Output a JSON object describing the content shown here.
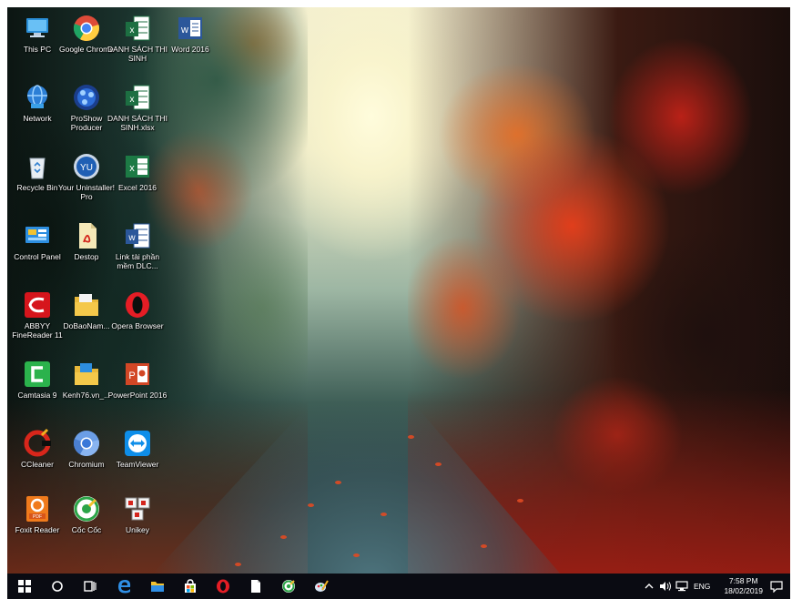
{
  "desktop": {
    "icons": [
      {
        "label": "This PC",
        "icon": "this-pc-icon"
      },
      {
        "label": "Google Chrome",
        "icon": "chrome-icon"
      },
      {
        "label": "DANH SÁCH THI SINH",
        "icon": "excel-file-icon"
      },
      {
        "label": "Word 2016",
        "icon": "word-icon"
      },
      {
        "label": "Network",
        "icon": "network-icon"
      },
      {
        "label": "ProShow Producer",
        "icon": "proshow-icon"
      },
      {
        "label": "DANH SÁCH THI SINH.xlsx",
        "icon": "excel-file-icon"
      },
      {
        "label": "Recycle Bin",
        "icon": "recycle-bin-icon"
      },
      {
        "label": "Your Uninstaller! Pro",
        "icon": "uninstaller-icon"
      },
      {
        "label": "Excel 2016",
        "icon": "excel-icon"
      },
      {
        "label": "Control Panel",
        "icon": "control-panel-icon"
      },
      {
        "label": "Destop",
        "icon": "pdf-file-icon"
      },
      {
        "label": "Link tài phần mềm DLC...",
        "icon": "word-file-icon"
      },
      {
        "label": "ABBYY FineReader 11",
        "icon": "abbyy-icon"
      },
      {
        "label": "DoBaoNam...",
        "icon": "folder-icon"
      },
      {
        "label": "Opera Browser",
        "icon": "opera-icon"
      },
      {
        "label": "Camtasia 9",
        "icon": "camtasia-icon"
      },
      {
        "label": "Kenh76.vn_...",
        "icon": "folder-file-icon"
      },
      {
        "label": "PowerPoint 2016",
        "icon": "powerpoint-icon"
      },
      {
        "label": "CCleaner",
        "icon": "ccleaner-icon"
      },
      {
        "label": "Chromium",
        "icon": "chromium-icon"
      },
      {
        "label": "TeamViewer",
        "icon": "teamviewer-icon"
      },
      {
        "label": "Foxit Reader",
        "icon": "foxit-icon"
      },
      {
        "label": "Cốc Cốc",
        "icon": "coccoc-icon"
      },
      {
        "label": "Unikey",
        "icon": "unikey-icon"
      }
    ]
  },
  "taskbar": {
    "items": [
      "start-icon",
      "search-icon",
      "task-view-icon",
      "edge-icon",
      "file-explorer-icon",
      "store-icon",
      "opera-icon",
      "document-icon",
      "coccoc-icon",
      "paint-icon"
    ],
    "tray": {
      "language": "ENG",
      "time": "7:58 PM",
      "date": "18/02/2019"
    }
  }
}
